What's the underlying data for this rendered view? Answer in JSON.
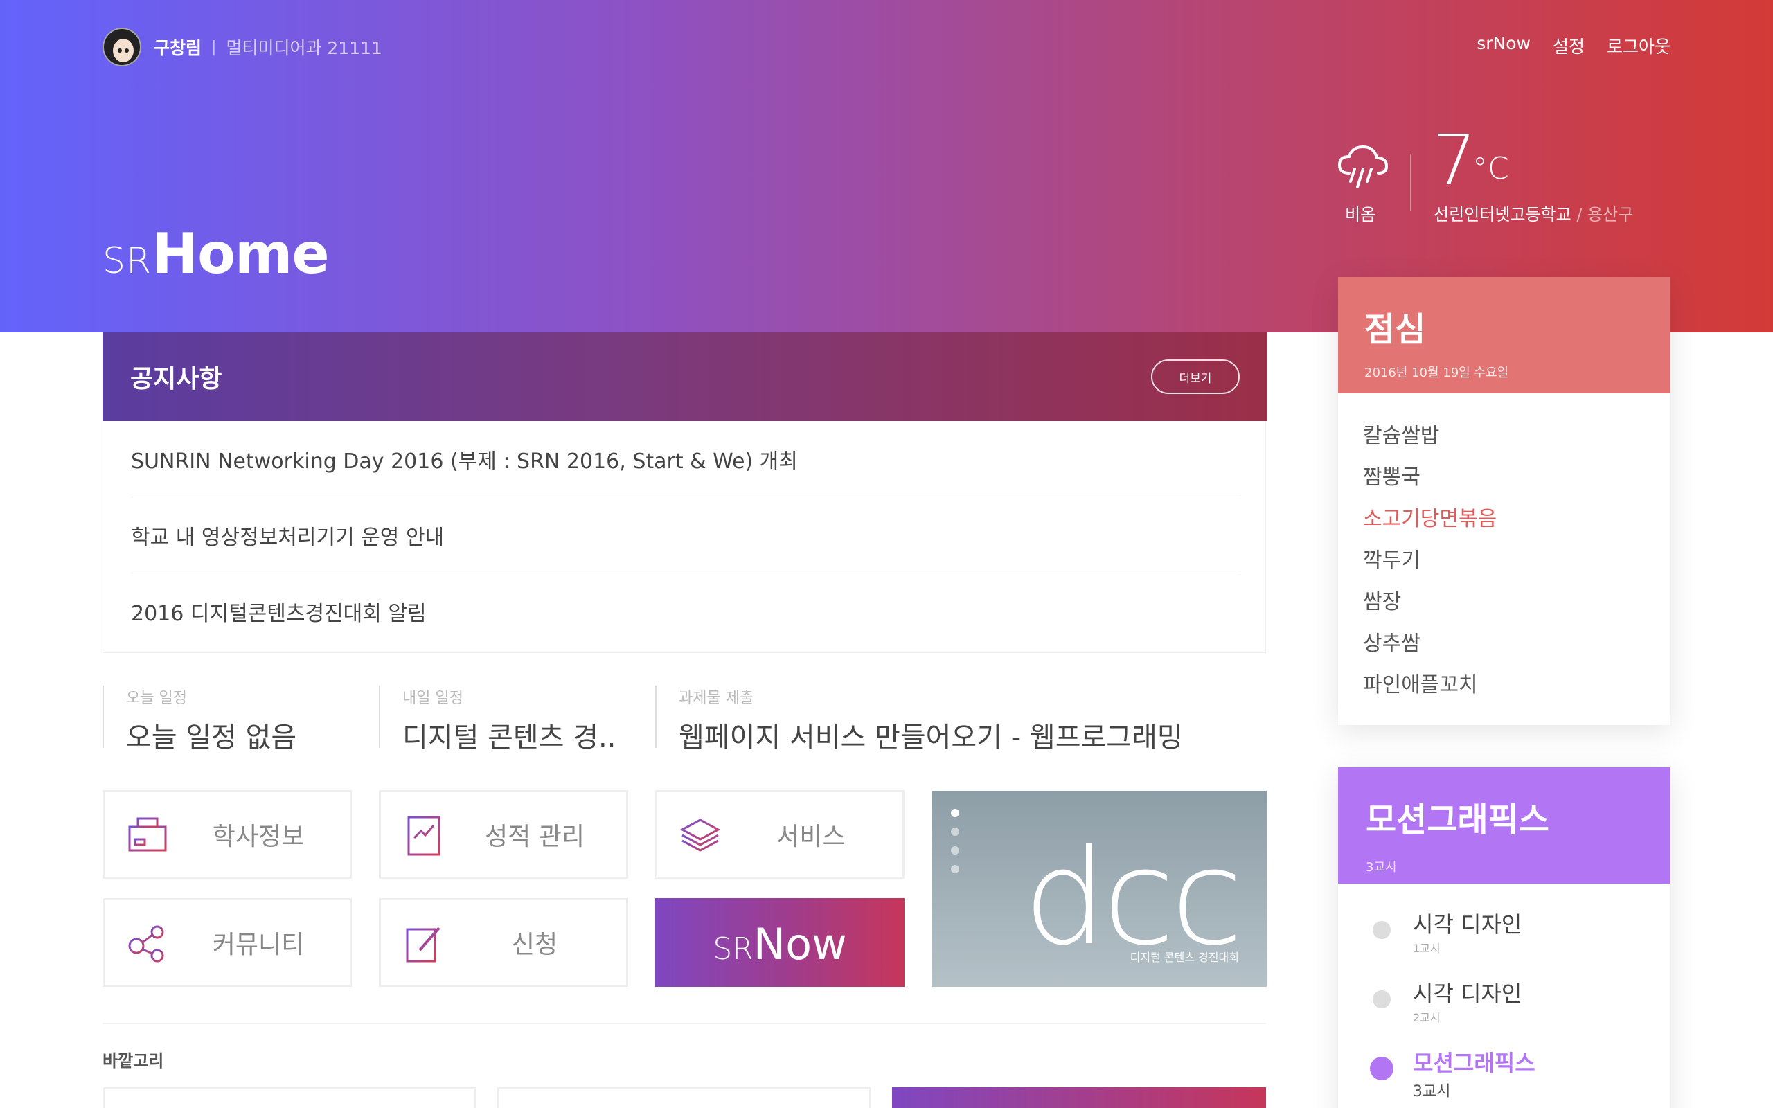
{
  "user": {
    "name": "구창림",
    "separator": "|",
    "dept": "멀티미디어과 21111"
  },
  "topnav": {
    "srnow": "srNow",
    "settings": "설정",
    "logout": "로그아웃"
  },
  "logo": {
    "prefix": "SR",
    "main": "Home"
  },
  "weather": {
    "condition": "비옴",
    "temp": "7",
    "unit": "°C",
    "school": "선린인터넷고등학교",
    "district": "/ 용산구",
    "icon": "rain-cloud-icon"
  },
  "notice": {
    "title": "공지사항",
    "more": "더보기",
    "items": [
      "SUNRIN Networking Day 2016 (부제 : SRN 2016, Start & We) 개최",
      "학교 내 영상정보처리기기 운영 안내",
      "2016 디지털콘텐츠경진대회 알림"
    ]
  },
  "schedule": {
    "today": {
      "label": "오늘 일정",
      "value": "오늘 일정 없음"
    },
    "tomorrow": {
      "label": "내일 일정",
      "value": "디지털 콘텐츠 경.."
    },
    "assignment": {
      "label": "과제물 제출",
      "value": "웹페이지 서비스 만들어오기 - 웹프로그래밍"
    }
  },
  "menus": {
    "academic": "학사정보",
    "grades": "성적 관리",
    "service": "서비스",
    "community": "커뮤니티",
    "apply": "신청"
  },
  "srnow_tile": {
    "prefix": "SR",
    "main": "Now"
  },
  "banner": {
    "logo": "dcc",
    "caption": "디지털 콘텐츠 경진대회"
  },
  "bag": {
    "label": "바깥고리"
  },
  "lunch": {
    "title": "점심",
    "date": "2016년 10월 19일 수요일",
    "items": [
      "칼슘쌀밥",
      "짬뽕국",
      "소고기당면볶음",
      "깍두기",
      "쌈장",
      "상추쌈",
      "파인애플꼬치"
    ]
  },
  "timetable": {
    "title": "모션그래픽스",
    "period": "3교시",
    "items": [
      {
        "name": "시각 디자인",
        "period": "1교시"
      },
      {
        "name": "시각 디자인",
        "period": "2교시"
      },
      {
        "name": "모션그래픽스",
        "period": "3교시"
      }
    ]
  },
  "colors": {
    "hero_start": "#6363fb",
    "hero_end": "#d33a37",
    "lunch_accent": "#e27474",
    "timetable_accent": "#b276f5"
  }
}
